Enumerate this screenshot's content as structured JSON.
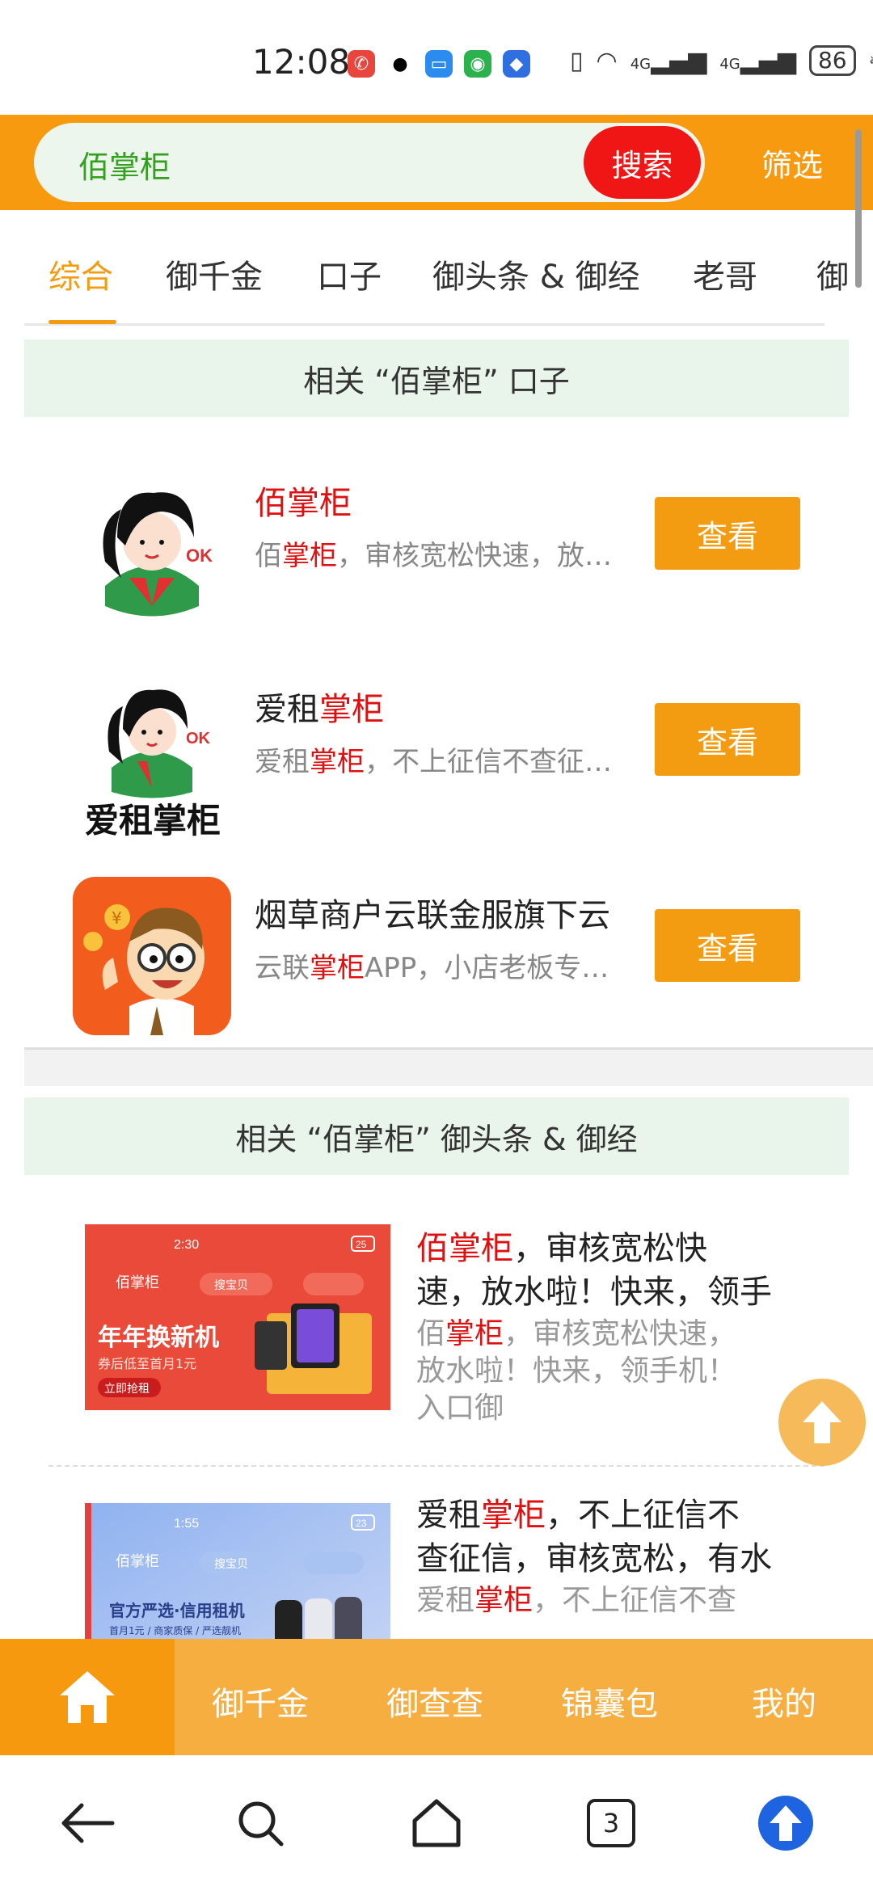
{
  "status_bar": {
    "time": "12:08",
    "network_1": "4G",
    "network_2": "4G",
    "battery": "86"
  },
  "header": {
    "search_value": "佰掌柜",
    "search_button": "搜索",
    "filter_label": "筛选",
    "accent_color": "#f79a10"
  },
  "tabs": [
    "综合",
    "御千金",
    "口子",
    "御头条 & 御经",
    "老哥",
    "御"
  ],
  "sections": {
    "apps_header": "相关 “佰掌柜” 口子",
    "articles_header": "相关 “佰掌柜” 御头条 & 御经"
  },
  "apps": [
    {
      "title_pre": "",
      "title_hl": "佰掌柜",
      "title_post": "",
      "desc_pre": "佰",
      "desc_hl": "掌柜",
      "desc_post": "，审核宽松快速，放水啦！快来，领手机！",
      "button": "查看"
    },
    {
      "title_pre": "爱租",
      "title_hl": "掌柜",
      "title_post": "",
      "desc_pre": "爱租",
      "desc_hl": "掌柜",
      "desc_post": "，不上征信不查征信，审核宽松",
      "button": "查看",
      "logo_text": "爱租掌柜"
    },
    {
      "title_pre": "烟草商户云联金服旗下云",
      "title_hl": "",
      "title_post": "",
      "desc_pre": "云联",
      "desc_hl": "掌柜",
      "desc_post": "APP，小店老板专属借款平台",
      "button": "查看"
    }
  ],
  "articles": [
    {
      "title_l1_hl": "佰掌柜",
      "title_l1_post": "，审核宽松快",
      "title_l2": "速，放水啦！快来，领手",
      "desc_l1_pre": "佰",
      "desc_l1_hl": "掌柜",
      "desc_l1_post": "，审核宽松快速，",
      "desc_l2": "放水啦！快来，领手机！",
      "desc_l3": "入口御",
      "thumb": {
        "time": "2:30",
        "battery": "25",
        "app": "佰掌柜",
        "search": "搜宝贝",
        "headline": "年年换新机",
        "sub": "券后低至首月1元",
        "cta": "立即抢租"
      }
    },
    {
      "title_l1_pre": "爱租",
      "title_l1_hl": "掌柜",
      "title_l1_post": "，不上征信不",
      "title_l2": "查征信，审核宽松，有水",
      "desc_l1_pre": "爱租",
      "desc_l1_hl": "掌柜",
      "desc_l1_post": "，不上征信不查",
      "thumb": {
        "time": "1:55",
        "battery": "23",
        "app": "佰掌柜",
        "search": "搜宝贝",
        "headline": "官方严选·信用租机",
        "sub": "首月1元 / 商家质保 / 严选靓机"
      }
    }
  ],
  "bottom_nav": [
    "御千金",
    "御查查",
    "锦囊包",
    "我的"
  ],
  "system_bar": {
    "tab_count": "3"
  }
}
